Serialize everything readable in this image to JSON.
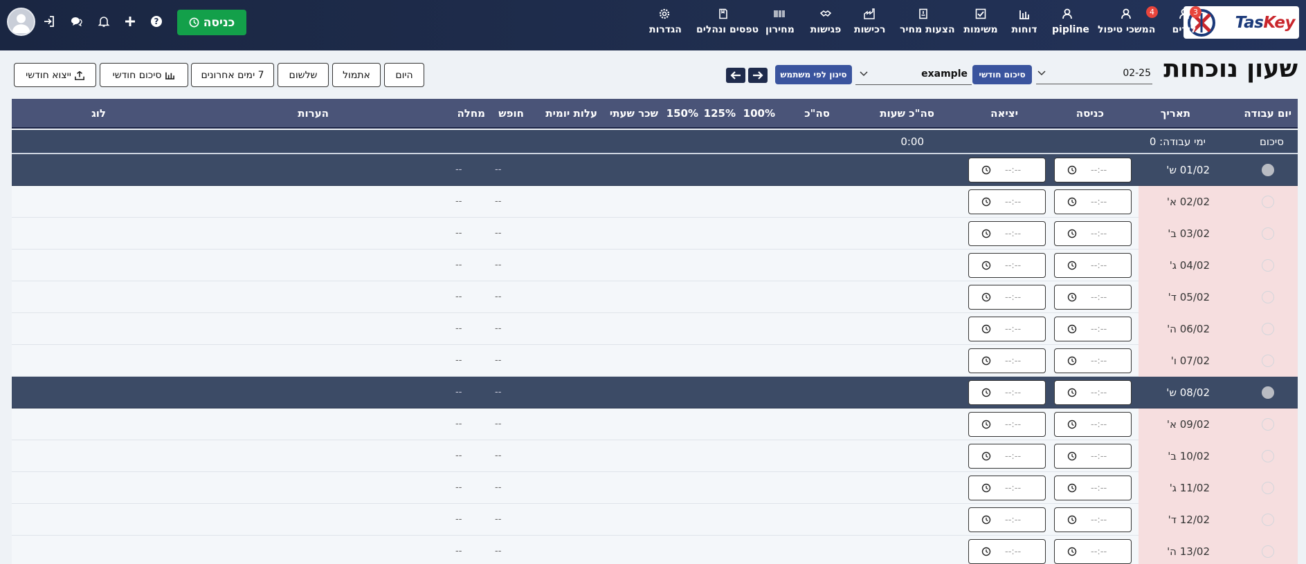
{
  "nav": {
    "items": [
      {
        "label": "לידים",
        "icon": "user-icon",
        "badge": "3"
      },
      {
        "label": "המשכי טיפול",
        "icon": "user-icon",
        "badge": "4"
      },
      {
        "label": "pipline",
        "icon": "user-icon"
      },
      {
        "label": "דוחות",
        "icon": "bar-chart-icon"
      },
      {
        "label": "משימות",
        "icon": "checkbox-icon"
      },
      {
        "label": "הצעות מחיר",
        "icon": "file-icon"
      },
      {
        "label": "רכישות",
        "icon": "factory-icon"
      },
      {
        "label": "פגישות",
        "icon": "handshake-icon"
      },
      {
        "label": "מחירון",
        "icon": "barcode-icon"
      },
      {
        "label": "טפסים ונהלים",
        "icon": "book-icon"
      },
      {
        "label": "הגדרות",
        "icon": "gear-icon"
      }
    ],
    "enter_label": "כניסה"
  },
  "logo": {
    "text_a": "Tas",
    "text_b": "Key"
  },
  "page": {
    "title": "שעון נוכחות",
    "month_value": "02-25",
    "monthly_summary_label": "סיכום חודשי",
    "user_value": "example",
    "filter_by_user_label": "סינון לפי משתמש"
  },
  "range_buttons": {
    "today": "היום",
    "yesterday": "אתמול",
    "day_before": "שלשום",
    "last7": "7 ימים אחרונים",
    "monthly_summary": "סיכום חודשי",
    "monthly_export": "ייצוא חודשי"
  },
  "table": {
    "headers": {
      "work_day": "יום עבודה",
      "date": "תאריך",
      "entry": "כניסה",
      "exit": "יציאה",
      "total_hours": "סה\"כ שעות",
      "total": "סה\"כ",
      "p100": "100%",
      "p125": "125%",
      "p150": "150%",
      "hourly_wage": "שכר שעתי",
      "daily_cost": "עלות יומית",
      "vacation": "חופש",
      "sick": "מחלה",
      "notes": "הערות",
      "log": "לוג"
    },
    "summary": {
      "label": "סיכום",
      "work_days": "ימי עבודה: 0",
      "total_hours": "0:00"
    },
    "time_placeholder": "--:--",
    "empty": "--",
    "rows": [
      {
        "date": "01/02 ש'",
        "weekend": true
      },
      {
        "date": "02/02 א'",
        "weekend": false
      },
      {
        "date": "03/02 ב'",
        "weekend": false
      },
      {
        "date": "04/02 ג'",
        "weekend": false
      },
      {
        "date": "05/02 ד'",
        "weekend": false
      },
      {
        "date": "06/02 ה'",
        "weekend": false
      },
      {
        "date": "07/02 ו'",
        "weekend": false
      },
      {
        "date": "08/02 ש'",
        "weekend": true
      },
      {
        "date": "09/02 א'",
        "weekend": false
      },
      {
        "date": "10/02 ב'",
        "weekend": false
      },
      {
        "date": "11/02 ג'",
        "weekend": false
      },
      {
        "date": "12/02 ד'",
        "weekend": false
      },
      {
        "date": "13/02 ה'",
        "weekend": false
      }
    ]
  },
  "colors": {
    "nav_bg": "#1f2d4d",
    "enter_green": "#13a04a",
    "accent_blue": "#3a549e",
    "header_bg": "#4a5478",
    "weekend_row": "#3c4b66",
    "day_cell_pink": "#f6dedf",
    "badge_red": "#e8453c"
  }
}
